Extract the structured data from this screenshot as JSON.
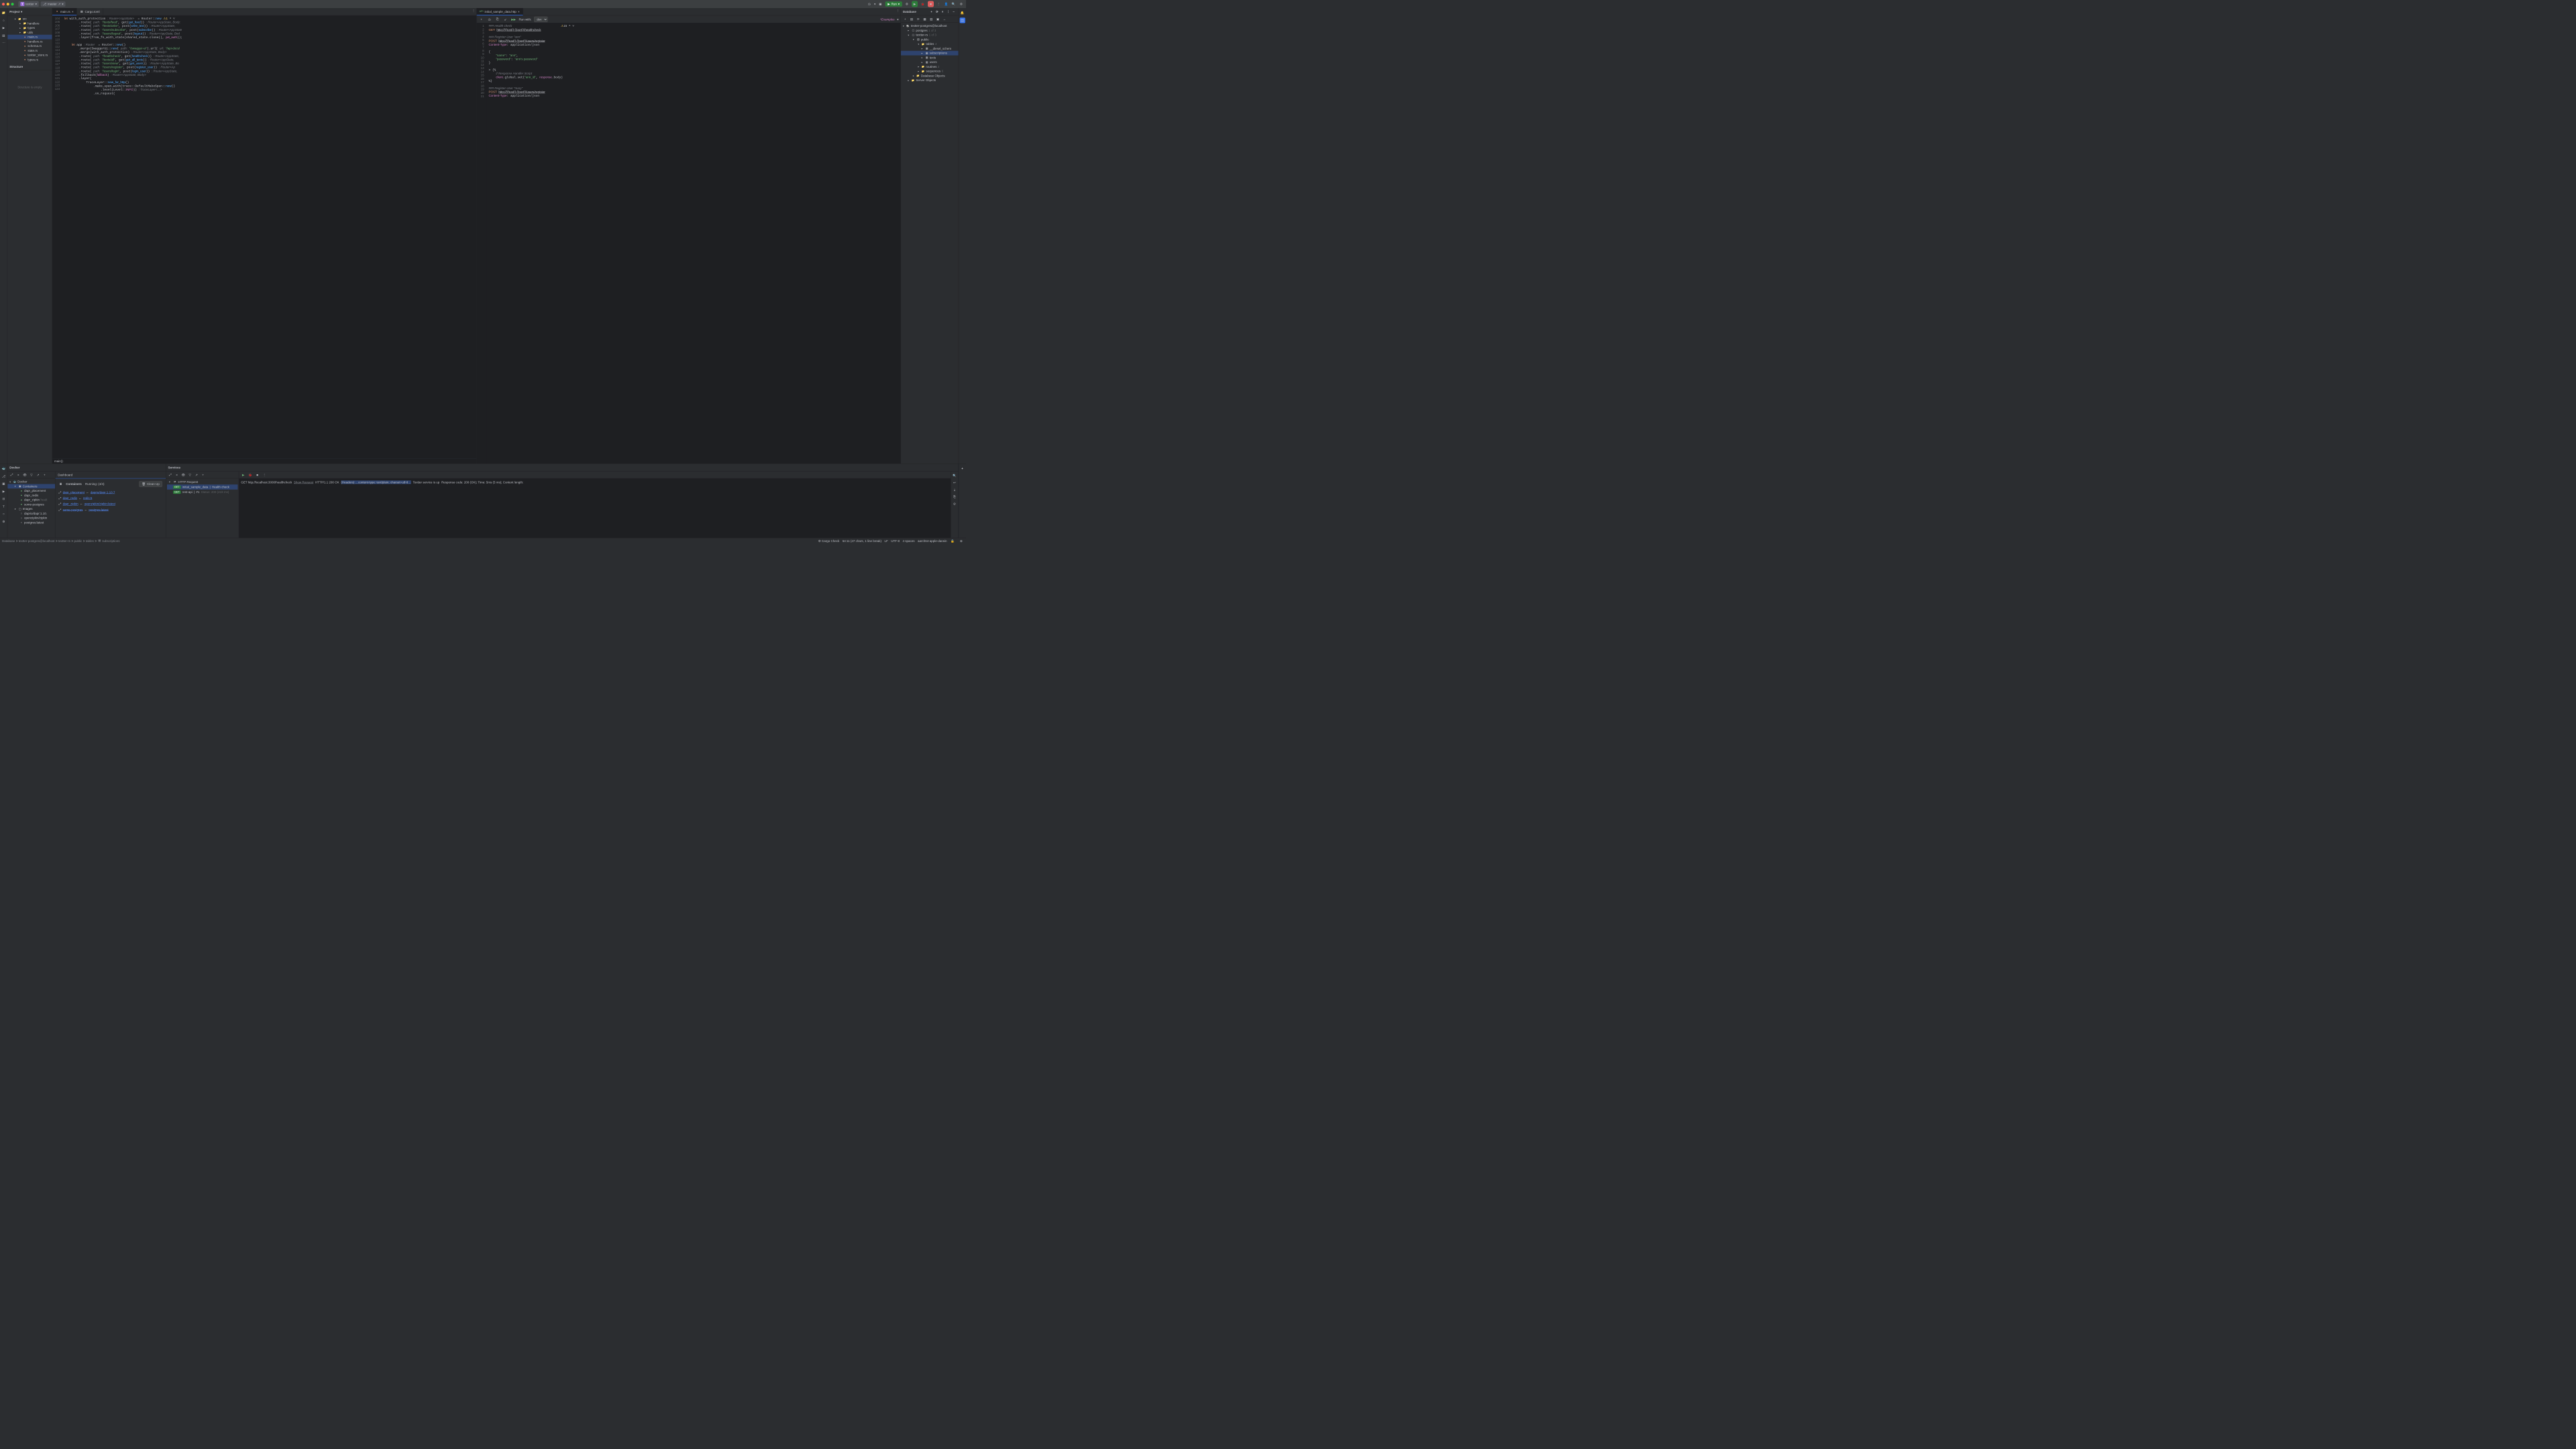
{
  "titlebar": {
    "project_badge": "T",
    "project_name": "textter",
    "branch": "master",
    "run_label": "Run"
  },
  "project_panel": {
    "title": "Project",
    "tree": {
      "src": "src",
      "handlers": "handlers",
      "types": "types",
      "utils": "utils",
      "main_rs": "main.rs",
      "handlers_rs": "handlers.rs",
      "schema_rs": "schema.rs",
      "state_rs": "state.rs",
      "textter_store": "textter_store.rs",
      "types_rs": "types.rs"
    },
    "structure_title": "Structure",
    "structure_empty": "Structure is empty"
  },
  "editor_tabs": {
    "main_rs": "main.rs",
    "cargo_toml": "Cargo.toml",
    "http_file": "initial_sample_data.http"
  },
  "code_left": {
    "breadcrumb": "main()",
    "lines": [
      104,
      105,
      106,
      107,
      108,
      109,
      110,
      111,
      112,
      113,
      114,
      115,
      116,
      117,
      118,
      119,
      120,
      121,
      122,
      123,
      124
    ],
    "l104": "let with_auth_protection : Router<AppState>  = Router::new",
    "l105": "        .route( path: \"/texts/feed\", get(get_feed)) : Router<AppState, Body:",
    "l106": "        .route( path: \"/texts/write\", post(write_text)) : Router<AppState,",
    "l107": "        .route( path: \"/users/subscribe\", post(subscribe)) : Router<AppState",
    "l108": "        .route( path: \"/users/logout\", post(logout)) : Router<AppState, Bod",
    "l109": "        .layer(from_fn_with_state(shared_state.clone(), jwt_auth));",
    "l110": "",
    "l111": "    let app : Router  = Router::new()",
    "l112": "        .merge(SwaggerUi::new( path: \"/swagger-ui\").url( url: \"/api-docs/",
    "l113": "        .merge(with_auth_protection) : Router<AppState, Body>",
    "l114": "        .route( path: \"/healthcheck\", get(healthcheck)) : Router<AppState,",
    "l115": "        .route( path: \"/texts/all\", get(get_all_texts)) : Router<AppState,",
    "l116": "        .route( path: \"/users/view\", get(get_users)) : Router<AppState, Bo",
    "l117": "        .route( path: \"/users/register\", post(register_user)) : Router<Ap",
    "l118": "        .route( path: \"/users/login\", post(login_user)) : Router<AppState,",
    "l119": "        .fallback(fallback) : Router<AppState, Body>",
    "l120": "        .layer(",
    "l121": "            TraceLayer::new_for_http()",
    "l122": "                .make_span_with(trace::DefaultMakeSpan::new()",
    "l123": "                    .level(Level::INFO)) : TraceLayer<…>",
    "l124": "                .on_request("
  },
  "code_right": {
    "run_with": "Run with:",
    "env": "dev",
    "examples": "*Examples",
    "warn_count": "1",
    "hint_count": "15",
    "lines": [
      1,
      2,
      3,
      4,
      5,
      6,
      7,
      8,
      9,
      10,
      11,
      12,
      13,
      14,
      15,
      16,
      17,
      18,
      19,
      20,
      21
    ],
    "l1": "### Health check",
    "l2": "GET http://{{host}}:{{port}}/healthcheck",
    "l3": "",
    "l4": "### Register User \"ann\"",
    "l5": "POST http://{{host}}:{{port}}/users/register",
    "l6": "Content-Type: application/json",
    "l7": "",
    "l8": "{",
    "l9": "    \"name\": \"ann\",",
    "l10": "    \"password\": \"ann's password\"",
    "l11": "}",
    "l12": "",
    "l13": "> {%",
    "l14": "    // Response Handler Script",
    "l15": "    client.global.set(\"ann_id\", response.body)",
    "l16": "%}",
    "l17": "",
    "l18": "### Register User \"mary\"",
    "l19": "POST http://{{host}}:{{port}}/users/register",
    "l20": "Content-Type: application/json",
    "l21": ""
  },
  "database": {
    "title": "Database",
    "connection": "textter-postgres@localhost",
    "postgres": "postgres",
    "postgres_count": "1 of 3",
    "textter_rs": "textter-rs",
    "textter_count": "1 of 3",
    "public": "public",
    "tables": "tables",
    "tables_count": "4",
    "diesel": "__diesel_schem",
    "subscriptions": "subscriptions",
    "texts": "texts",
    "users": "users",
    "routines": "routines",
    "routines_count": "2",
    "sequences": "sequences",
    "sequences_count": "6",
    "db_objects": "Database Objects",
    "server_objects": "Server Objects"
  },
  "docker": {
    "title": "Docker",
    "dashboard": "Dashboard",
    "docker_node": "Docker",
    "containers": "Containers",
    "dapr_placement": "dapr_placement",
    "dapr_redis": "dapr_redis",
    "dapr_zipkin": "dapr_zipkin",
    "dapr_zipkin_status": "healt",
    "some_postgres": "some-postgres",
    "images": "Images",
    "img_dapr": "daprio/dapr:1.10.",
    "img_zipkin": "openzipkin/zipkin",
    "img_postgres": "postgres:latest",
    "containers_heading": "Containers",
    "running": "Running: (4/4)",
    "cleanup": "Clean Up",
    "c1_name": "dapr_placement",
    "c1_img": "daprio/dapr:1.10.7",
    "c2_name": "dapr_redis",
    "c2_img": "redis:6",
    "c3_name": "dapr_zipkin",
    "c3_img": "openzipkin/zipkin:latest",
    "c4_name": "some-postgres",
    "c4_img": "postgres:latest"
  },
  "services": {
    "title": "Services",
    "http_request": "HTTP Request",
    "req1_name": "initial_sample_data",
    "req1_sub": "Health check",
    "req2_name": "rest-api",
    "req2_id": "#1",
    "req2_status": "Status: 200 (419 ms)",
    "badge_get": "GET",
    "console_l1": "GET http://localhost:3000/healthcheck",
    "console_show": "Show Request",
    "console_l2": "HTTP/1.1 200 OK",
    "console_l3": "(Headers) …content-type: text/plain; charset=utf-8…",
    "console_l4": "Textter service is up",
    "console_l5": "Response code: 200 (OK); Time: 5ms (5 ms); Content length: "
  },
  "status": {
    "breadcrumb": [
      "Database",
      "textter-postgres@localhost",
      "textter-rs",
      "public",
      "tables",
      "subscriptions"
    ],
    "cargo": "Cargo Check",
    "pos": "64:11 (47 chars, 1 line break)",
    "lf": "LF",
    "enc": "UTF-8",
    "indent": "4 spaces",
    "arch": "aarch64-apple-darwin"
  }
}
